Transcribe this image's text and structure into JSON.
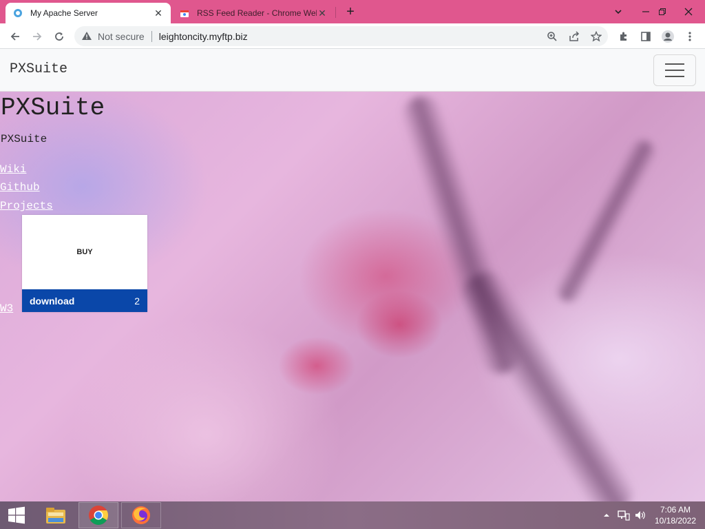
{
  "browser": {
    "tabs": [
      {
        "title": "My Apache Server",
        "active": true
      },
      {
        "title": "RSS Feed Reader - Chrome Web Store",
        "active": false
      }
    ],
    "address": {
      "security_label": "Not secure",
      "url": "leightoncity.myftp.biz"
    }
  },
  "page": {
    "navbar": {
      "brand": "PXSuite"
    },
    "heading": "PXSuite",
    "subheading": "PXSuite",
    "links": [
      "Wiki",
      "Github",
      "Projects",
      "W3"
    ],
    "card": {
      "buy_label": "BUY",
      "download_label": "download",
      "download_count": "2"
    }
  },
  "taskbar": {
    "clock_time": "7:06 AM",
    "clock_date": "10/18/2022"
  },
  "colors": {
    "tabstrip": "#e0578e",
    "download_bar": "#0a47a9"
  }
}
